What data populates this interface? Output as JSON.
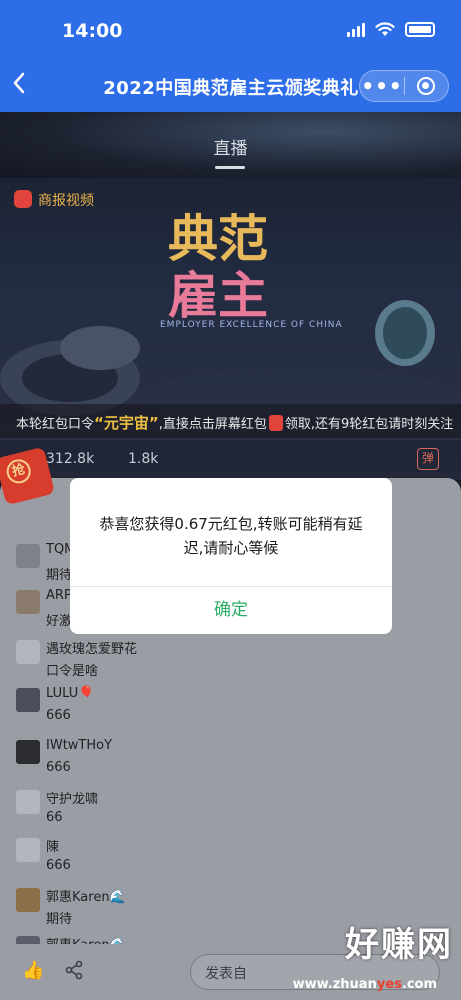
{
  "status_bar": {
    "time": "14:00"
  },
  "nav": {
    "back_glyph": "‹",
    "title": "2022中国典范雇主云颁奖典礼",
    "more_glyph": "•••"
  },
  "tab": {
    "label": "直播"
  },
  "video": {
    "channel_name": "商报视频",
    "logo_text_line1": "典范",
    "logo_text_line2": "雇主",
    "logo_caption": "EMPLOYER EXCELLENCE OF CHINA",
    "notice_prefix": "本轮红包口令",
    "notice_keyword": "“元宇宙”",
    "notice_mid": ",直接点击屏幕红包",
    "notice_suffix": "领取,还有9轮红包请时刻关注"
  },
  "stats": {
    "viewers": "312.8k",
    "likes": "1.8k",
    "danmu": "弹"
  },
  "red_packet": {
    "char": "抢"
  },
  "comments": [
    {
      "name": "TQM",
      "text": "期待"
    },
    {
      "name": "ARP",
      "text": "好激"
    },
    {
      "name": "遇玫瑰怎爱野花",
      "text": "口令是啥"
    },
    {
      "name": "LULU🎈",
      "text": "666"
    },
    {
      "name": "IWtwTHoY",
      "text": "666"
    },
    {
      "name": "守护龙啸",
      "text": "66"
    },
    {
      "name": "陳",
      "text": "666"
    },
    {
      "name": "郭惠Karen🌊",
      "text": "期待"
    },
    {
      "name": "郭惠Karen🌊",
      "text": ""
    }
  ],
  "bottom": {
    "like_glyph": "👍",
    "share_glyph": "⋲",
    "input_placeholder": "发表自",
    "watermark": "好赚网",
    "watermark_url_a": "www.zhuan",
    "watermark_url_b": "yes",
    "watermark_url_c": ".com"
  },
  "dialog": {
    "message": "恭喜您获得0.67元红包,转账可能稍有延迟,请耐心等候",
    "confirm": "确定"
  },
  "colors": {
    "brand_blue": "#2d6ee8",
    "confirm_green": "#2aae67",
    "red_packet": "#d83c2c"
  }
}
